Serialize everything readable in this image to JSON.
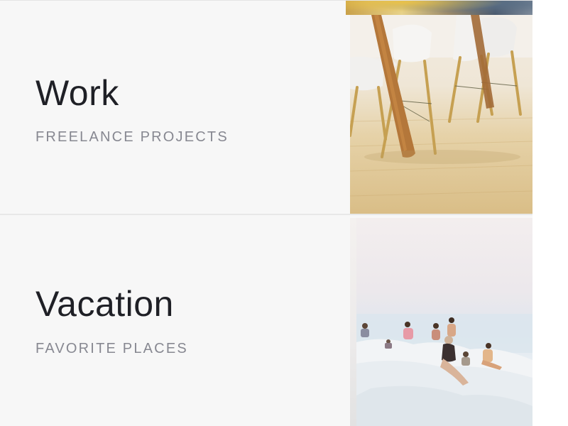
{
  "cards": [
    {
      "title": "Work",
      "subtitle": "FREELANCE PROJECTS",
      "image_icon": "table-chairs-photo"
    },
    {
      "title": "Vacation",
      "subtitle": "FAVORITE PLACES",
      "image_icon": "beach-rocks-photo"
    }
  ],
  "colors": {
    "card_background": "#f7f7f7",
    "title": "#1f2026",
    "subtitle": "#878891",
    "divider": "#e8e8e8"
  }
}
